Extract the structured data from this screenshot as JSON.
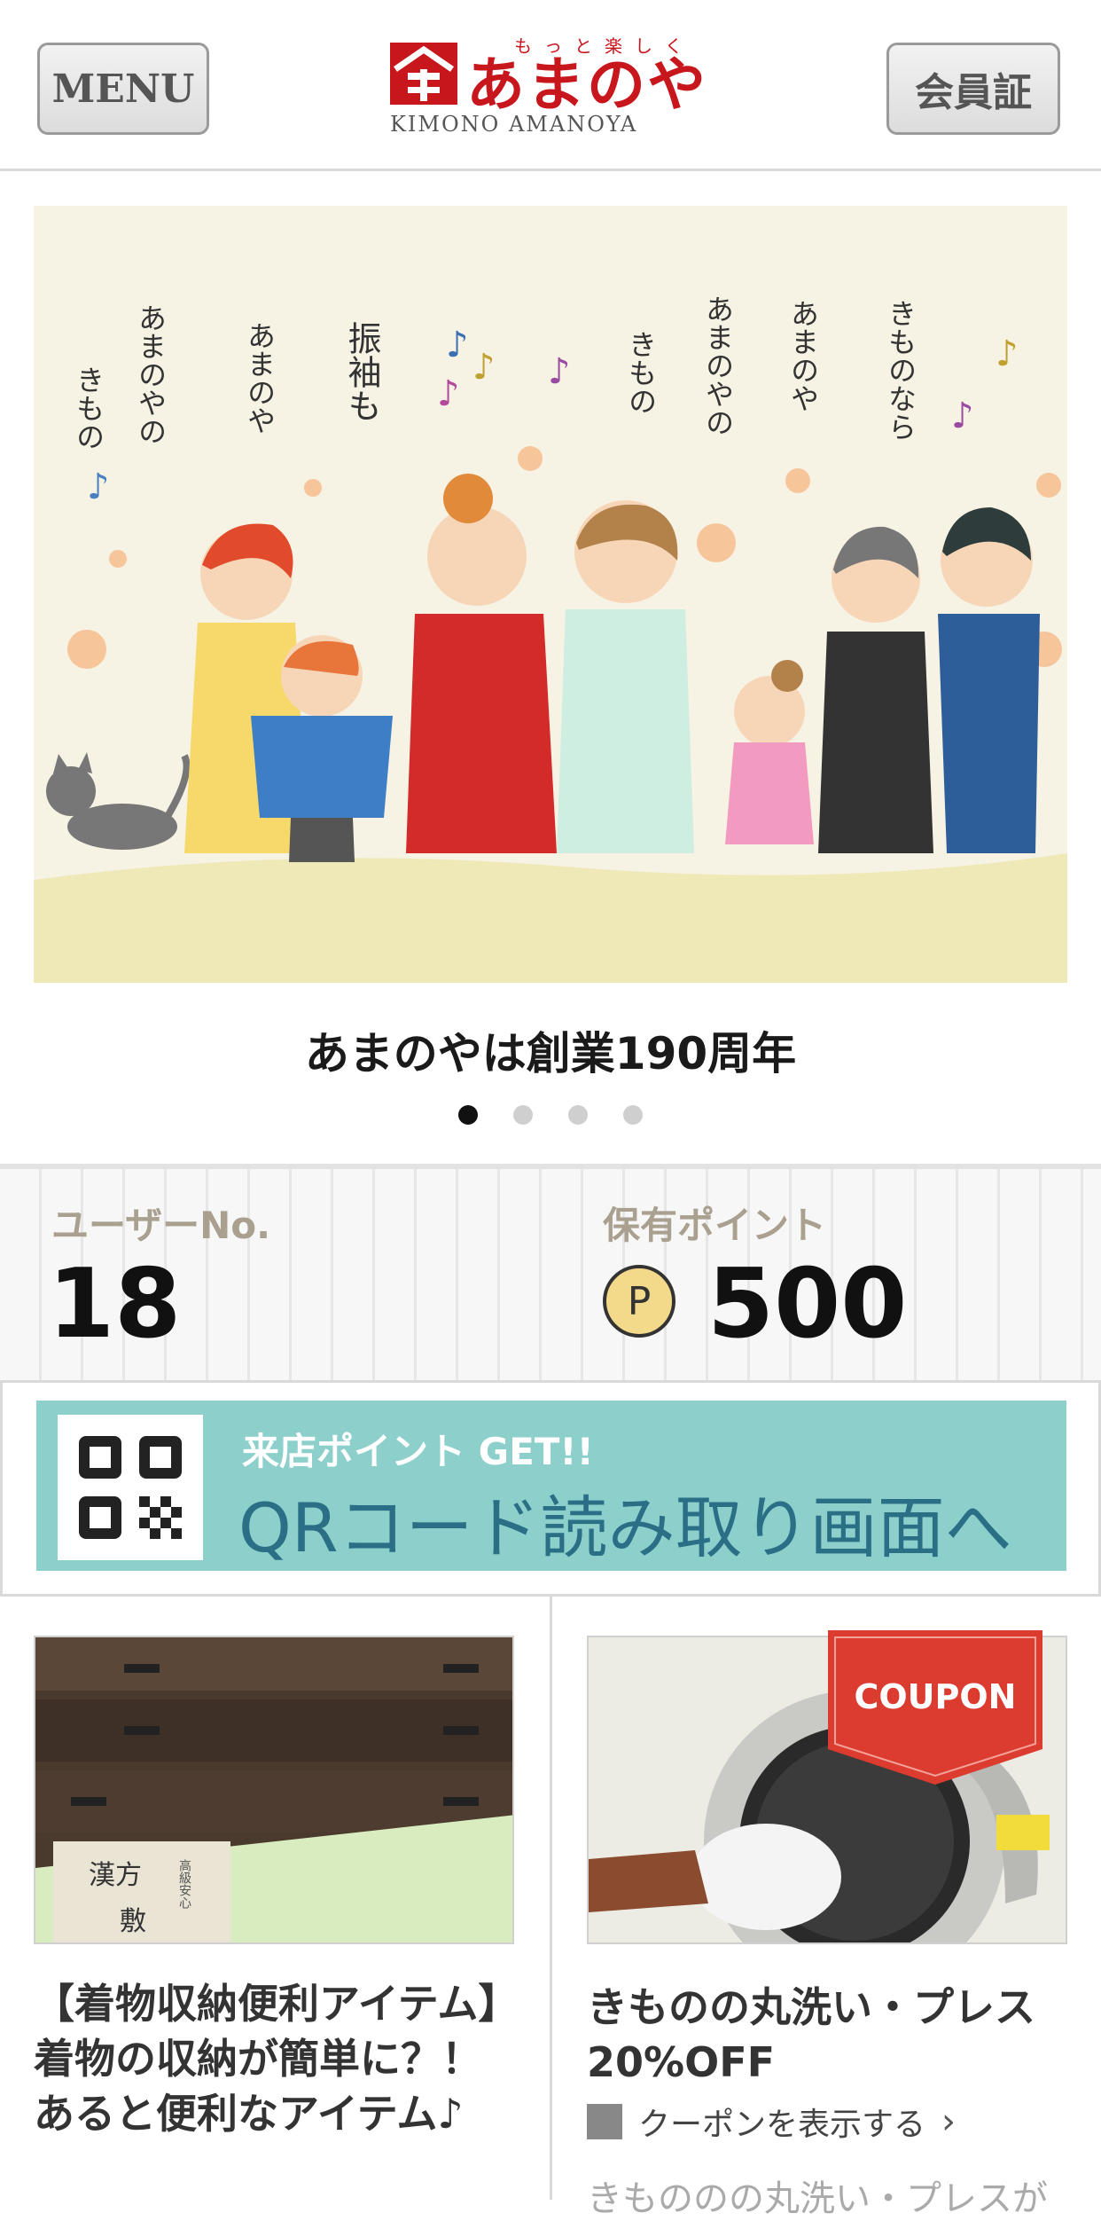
{
  "header": {
    "menu_label": "MENU",
    "member_card_label": "会員証",
    "logo": {
      "name": "あまのや",
      "ruby": "もっと楽しく",
      "subtitle": "KIMONO AMANOYA"
    }
  },
  "banner": {
    "lyrics": [
      "きもの",
      "あまのやの",
      "あまのや",
      "振袖も",
      "きもの",
      "あまのやの",
      "あまのや",
      "きものなら"
    ],
    "caption": "あまのやは創業190周年",
    "slides_total": 4,
    "active_slide": 1
  },
  "stats": {
    "user_no_label": "ユーザーNo.",
    "user_no": "18",
    "points_label": "保有ポイント",
    "coin_symbol": "P",
    "points": "500"
  },
  "qr_banner": {
    "small_text": "来店ポイント GET!!",
    "big_text": "QRコード読み取り画面へ"
  },
  "cards": [
    {
      "title": "【着物収納便利アイテム】着物の収納が簡単に？！ あると便利なアイテム♪",
      "image_text": [
        "漢方",
        "敷",
        "高級安心"
      ]
    },
    {
      "ribbon": "COUPON",
      "title": "きものの丸洗い・プレス20%OFF",
      "link_label": "クーポンを表示する",
      "body_preview": "きもののの丸洗い・プレスが"
    }
  ],
  "colors": {
    "brand_red": "#c8161d",
    "teal": "#8ccfcb",
    "text_blue": "#2a6f86"
  }
}
